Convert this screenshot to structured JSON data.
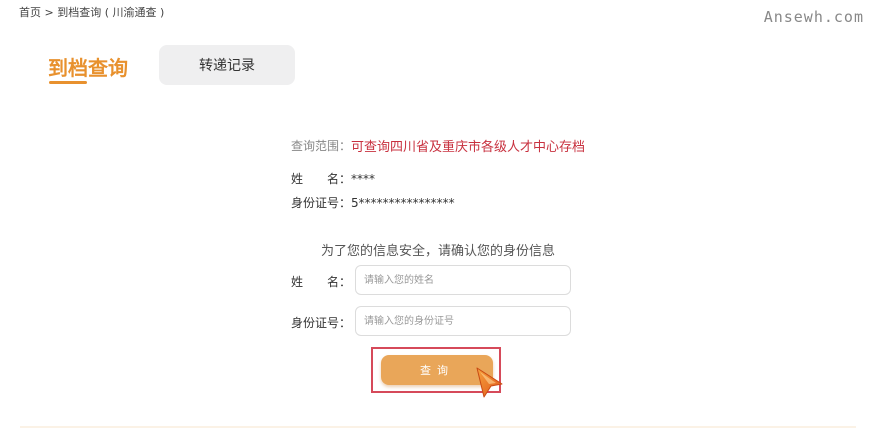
{
  "breadcrumb": {
    "text": "首页 > 到档查询 ( 川渝通查 )"
  },
  "watermark": "Ansewh.com",
  "tabs": [
    {
      "label": "到档查询",
      "active": true
    },
    {
      "label": "转递记录",
      "active": false
    }
  ],
  "query_scope": {
    "label": "查询范围：",
    "value": "可查询四川省及重庆市各级人才中心存档"
  },
  "user_info": {
    "name_label": "姓　　名：",
    "name_value": "****",
    "id_label": "身份证号：",
    "id_value": "5****************"
  },
  "verify": {
    "notice": "为了您的信息安全，请确认您的身份信息",
    "name_label": "姓　　名：",
    "name_placeholder": "请输入您的姓名",
    "name_value": "",
    "id_label": "身份证号：",
    "id_placeholder": "请输入您的身份证号",
    "id_value": ""
  },
  "query_button": {
    "label": "查询"
  },
  "colors": {
    "accent": "#e8912e",
    "button": "#e9a659",
    "scope_text": "#c8313f",
    "highlight_frame": "#d64a5a",
    "tab_inactive_bg": "#efeff0"
  },
  "icons": {
    "cursor": "pointer-cursor-icon"
  }
}
